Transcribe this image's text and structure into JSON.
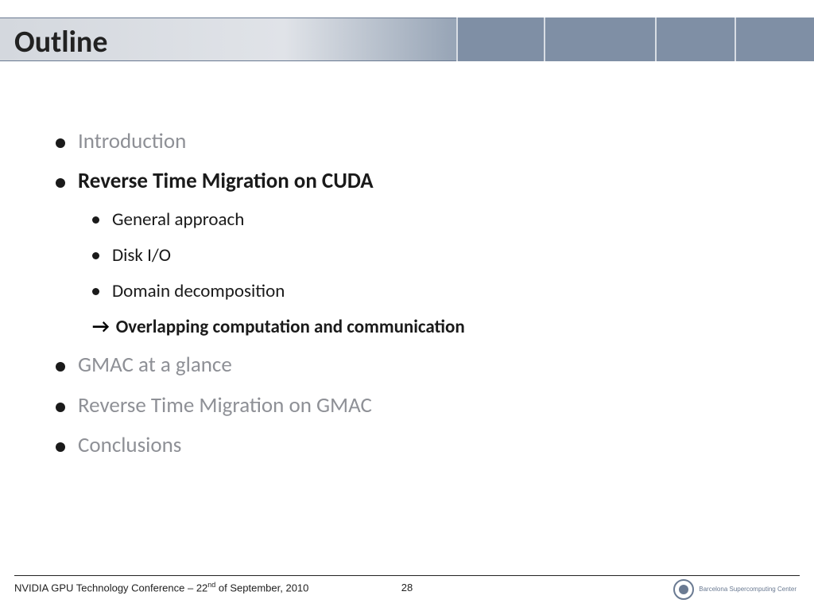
{
  "header": {
    "title": "Outline"
  },
  "items": {
    "i0": {
      "label": "Introduction"
    },
    "i1": {
      "label": "Reverse Time Migration on CUDA"
    },
    "i2": {
      "label": "GMAC at a glance"
    },
    "i3": {
      "label": "Reverse Time Migration on GMAC"
    },
    "i4": {
      "label": "Conclusions"
    }
  },
  "sub": {
    "s0": {
      "label": "General approach"
    },
    "s1": {
      "label": "Disk I/O"
    },
    "s2": {
      "label": "Domain decomposition"
    },
    "s3": {
      "label": "Overlapping computation and communication"
    }
  },
  "footer": {
    "conference_prefix": "NVIDIA GPU Technology Conference – 22",
    "conference_suffix": " of September, 2010",
    "ord": "nd",
    "page": "28",
    "logo": "Barcelona\nSupercomputing\nCenter"
  }
}
